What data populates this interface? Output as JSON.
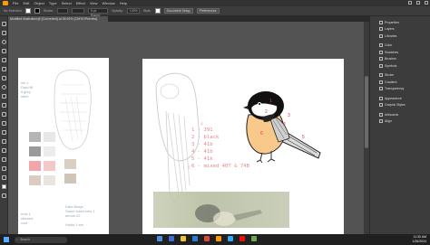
{
  "menubar": {
    "items": [
      "File",
      "Edit",
      "Object",
      "Type",
      "Select",
      "Effect",
      "View",
      "Window",
      "Help"
    ]
  },
  "controlbar": {
    "fill_label": "No Selection",
    "stroke_label": "Stroke:",
    "stroke_value": "",
    "brush_label": "5 pt. Round",
    "opacity_label": "Opacity:",
    "opacity_value": "100%",
    "style_label": "Style:",
    "doc_setup": "Document Setup",
    "preferences": "Preferences"
  },
  "document_tab": {
    "title": "Modified Illustration@ [Converted] at 36.92% (CMYK/Preview)"
  },
  "artboard1": {
    "note_top": "ink 1\nDark fill\nlt grey\nsteel",
    "note_bottom": "Dark Beige\nSame fossil ents 1\nstrook 02\n\nHolds 1.set",
    "note_left": "ents 1\nsfreaed\ncost",
    "swatch_labels": [
      "6",
      "",
      "",
      "",
      ""
    ]
  },
  "artboard2": {
    "legend": "1 - 391\n2 - black\n3 - 41b\n4 - 41b\n5 - 41k\n6 - mixed 40T & 74B",
    "labels_color": [
      "1",
      "2",
      "3",
      "4",
      "5",
      "6"
    ],
    "labels_ghost": [
      "4",
      "5"
    ]
  },
  "panels": {
    "group1": [
      "Properties",
      "Layers",
      "Libraries"
    ],
    "group2": [
      "Color",
      "Swatches",
      "Brushes",
      "Symbols"
    ],
    "group3": [
      "Stroke",
      "Gradient",
      "Transparency"
    ],
    "group4": [
      "Appearance",
      "Graphic Styles"
    ],
    "group5": [
      "Artboards",
      "Align"
    ]
  },
  "taskbar": {
    "search_placeholder": "Search",
    "time": "11:30 AM",
    "date": "1/26/2024"
  },
  "colors": {
    "accent": "#ff9a00",
    "legend_text": "#e8868a",
    "label_red": "#e0393e",
    "chickadee_belly": "#f8c98a"
  }
}
